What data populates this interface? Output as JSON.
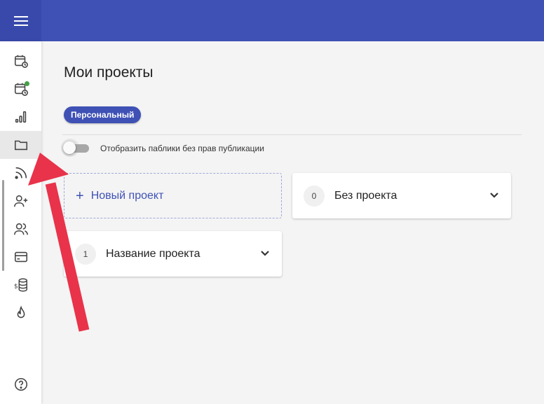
{
  "header": {
    "menu_icon": "hamburger-menu-icon",
    "color": "#3f51b5"
  },
  "sidebar": {
    "items": [
      {
        "name": "calendar-clock-icon",
        "active": false
      },
      {
        "name": "calendar-clock-notify-icon",
        "active": false,
        "has_dot": true
      },
      {
        "name": "bar-chart-icon",
        "active": false
      },
      {
        "name": "folder-icon",
        "active": true
      },
      {
        "name": "rss-icon",
        "active": false
      },
      {
        "name": "add-user-icon",
        "active": false
      },
      {
        "name": "users-icon",
        "active": false
      },
      {
        "name": "credit-card-icon",
        "active": false
      },
      {
        "name": "dollar-database-icon",
        "active": false
      },
      {
        "name": "fire-icon",
        "active": false
      },
      {
        "name": "help-circle-icon",
        "active": false
      }
    ]
  },
  "main": {
    "title": "Мои проекты",
    "filter_chip": "Персональный",
    "toggle": {
      "label": "Отобразить паблики без прав публикации",
      "checked": false
    },
    "new_project_label": "Новый проект",
    "projects": [
      {
        "count": "0",
        "name": "Без проекта"
      },
      {
        "count": "1",
        "name": "Название проекта"
      }
    ]
  },
  "colors": {
    "accent": "#3f51b5",
    "annotation_arrow": "#e8334a",
    "status_dot": "#43a047"
  }
}
